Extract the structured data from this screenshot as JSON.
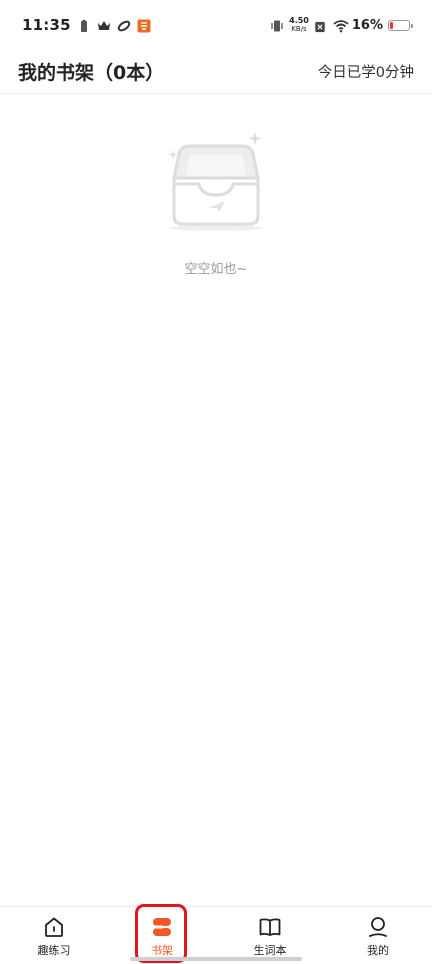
{
  "status_bar": {
    "time": "11:35",
    "net_speed_value": "4.50",
    "net_speed_unit": "KB/s",
    "battery_percent": "16%",
    "battery_level": 0.16,
    "icons": [
      "battery-saver-icon",
      "crown-icon",
      "sync-icon",
      "app-badge-icon",
      "vibrate-icon",
      "no-sim-icon",
      "wifi-icon",
      "battery-icon"
    ]
  },
  "header": {
    "title": "我的书架（0本）",
    "today_study": "今日已学0分钟"
  },
  "empty_state": {
    "icon": "empty-box-icon",
    "message": "空空如也~"
  },
  "bottom_nav": {
    "items": [
      {
        "label": "趣练习",
        "icon": "home-icon",
        "active": false
      },
      {
        "label": "书架",
        "icon": "bookshelf-icon",
        "active": true
      },
      {
        "label": "生词本",
        "icon": "book-icon",
        "active": false
      },
      {
        "label": "我的",
        "icon": "profile-icon",
        "active": false
      }
    ]
  },
  "colors": {
    "accent": "#f05a22",
    "highlight_box": "#e3141e",
    "text_primary": "#222222",
    "text_muted": "#9a9a9a"
  }
}
